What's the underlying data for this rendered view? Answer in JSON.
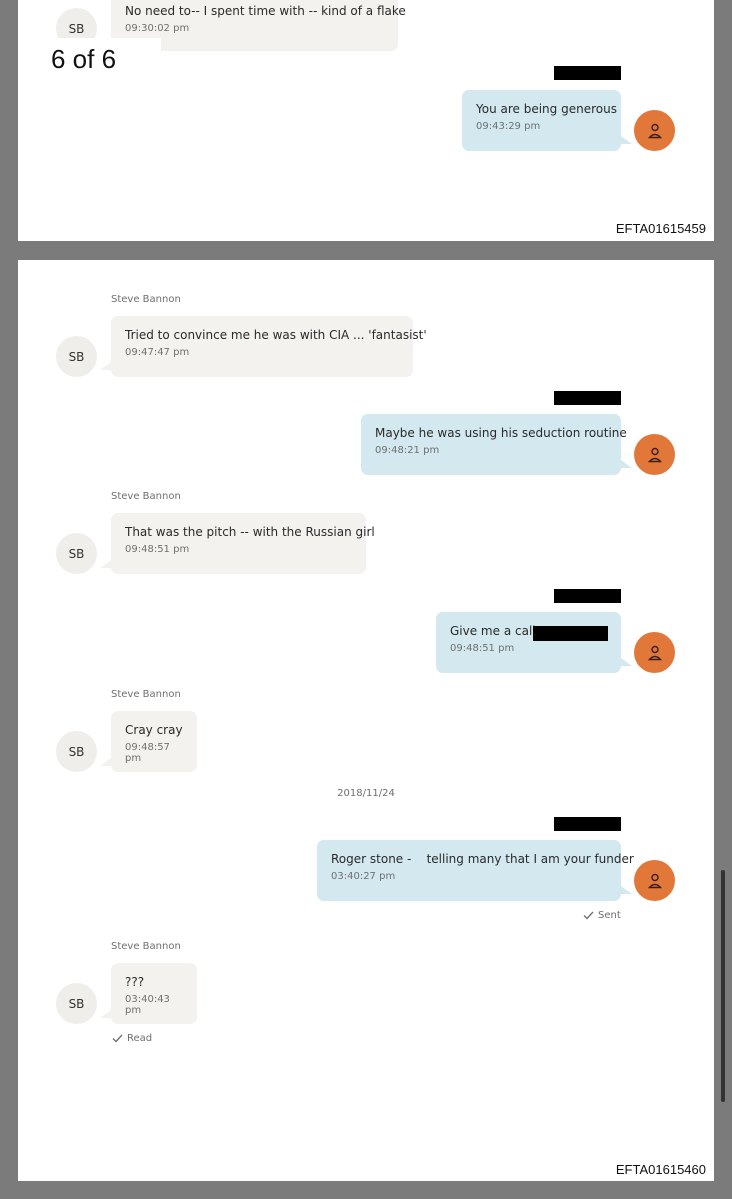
{
  "document": {
    "page_counter": "6 of 6",
    "page_ids": [
      "EFTA01615459",
      "EFTA01615460"
    ]
  },
  "page1": {
    "messages": [
      {
        "direction": "in",
        "avatar": "SB",
        "text": "No need to-- I spent time with -- kind of a flake",
        "time": "09:30:02 pm"
      },
      {
        "direction": "out",
        "text": "You are being generous",
        "time": "09:43:29 pm"
      }
    ]
  },
  "page2": {
    "messages": [
      {
        "direction": "in",
        "sender": "Steve Bannon",
        "avatar": "SB",
        "text": "Tried to convince me he was with CIA ... 'fantasist'",
        "time": "09:47:47 pm"
      },
      {
        "direction": "out",
        "text": "Maybe he was using his seduction routine",
        "time": "09:48:21 pm"
      },
      {
        "direction": "in",
        "sender": "Steve Bannon",
        "avatar": "SB",
        "text": "That was the pitch -- with the Russian girl",
        "time": "09:48:51 pm"
      },
      {
        "direction": "out",
        "text": "Give me a call.",
        "time": "09:48:51 pm"
      },
      {
        "direction": "in",
        "sender": "Steve Bannon",
        "avatar": "SB",
        "text": "Cray cray",
        "time": "09:48:57 pm"
      },
      {
        "direction": "out",
        "text": "Roger stone -    telling many that I am your funder",
        "time": "03:40:27 pm",
        "status": "Sent"
      },
      {
        "direction": "in",
        "sender": "Steve Bannon",
        "avatar": "SB",
        "text": "???",
        "time": "03:40:43 pm",
        "status": "Read"
      }
    ],
    "date_separator": "2018/11/24"
  },
  "colors": {
    "incoming_bubble": "#f3f2ef",
    "outgoing_bubble": "#d3e8ef",
    "outgoing_avatar": "#e2773a",
    "background": "#7b7b7b"
  },
  "icons": {
    "outgoing_avatar": "person-icon",
    "status": "check-icon"
  }
}
